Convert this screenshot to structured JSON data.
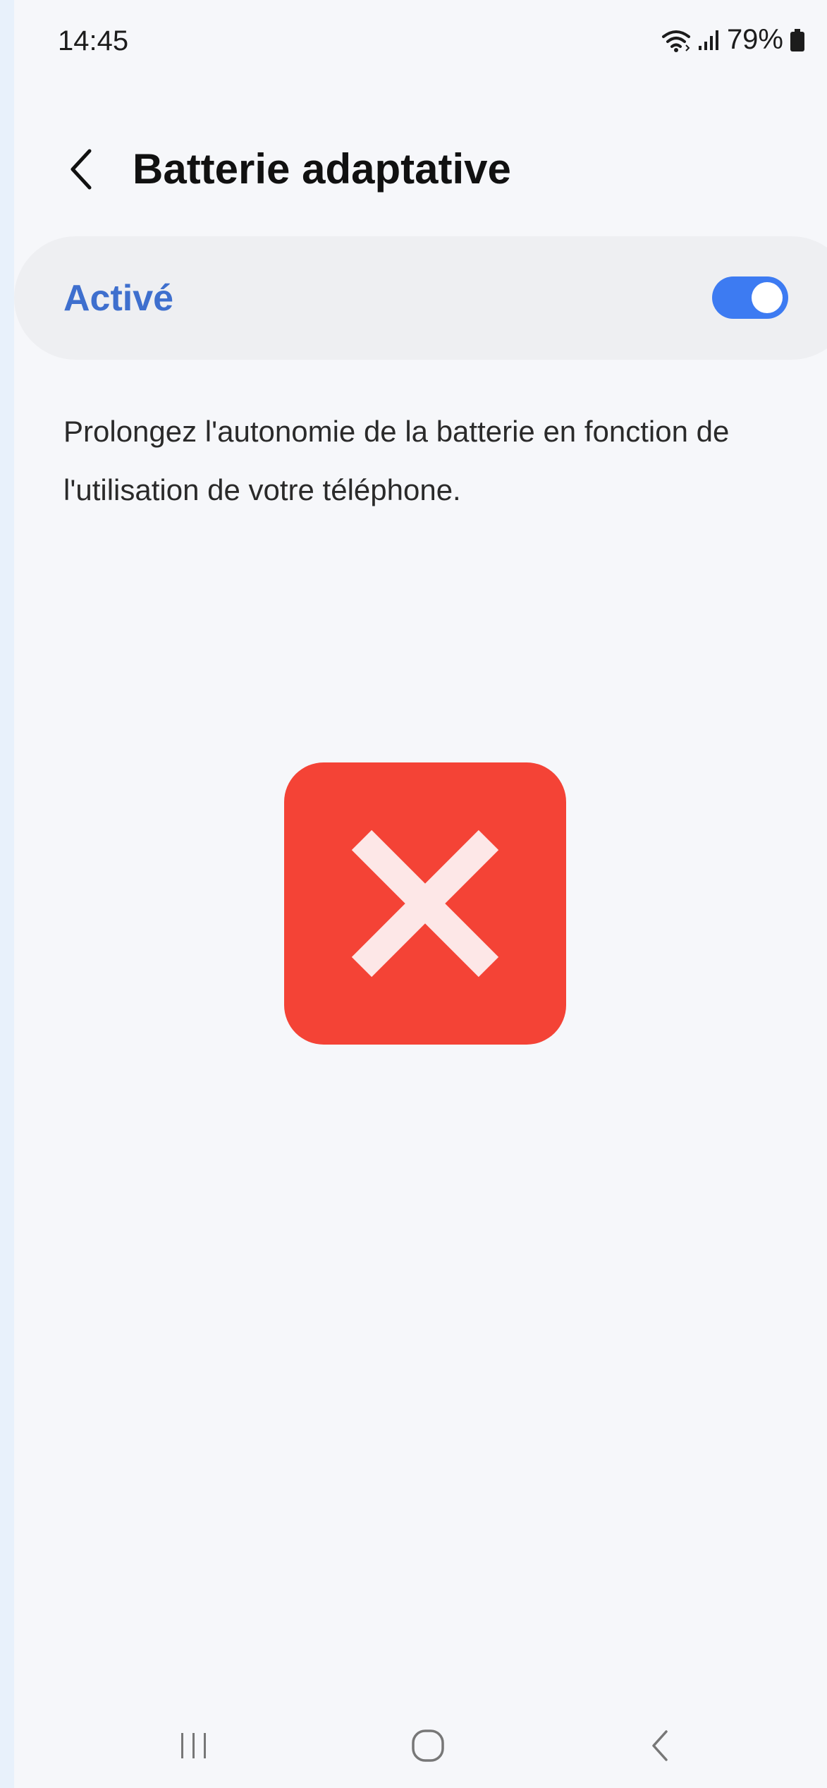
{
  "status_bar": {
    "time": "14:45",
    "battery_percent": "79%",
    "icons": [
      "wifi-icon",
      "signal-icon",
      "battery-icon"
    ]
  },
  "header": {
    "back_icon": "chevron-left-icon",
    "title": "Batterie adaptative"
  },
  "toggle": {
    "label": "Activé",
    "state": true,
    "accent_color": "#3d7bf2",
    "label_color": "#3e6fce"
  },
  "description": "Prolongez l'autonomie de la batterie en fonction de l'utilisation de votre téléphone.",
  "overlay": {
    "icon": "close-x-icon",
    "color": "#f44336"
  },
  "navigation_bar": {
    "recent_icon": "recent-apps-icon",
    "home_icon": "home-icon",
    "back_icon": "back-icon"
  }
}
